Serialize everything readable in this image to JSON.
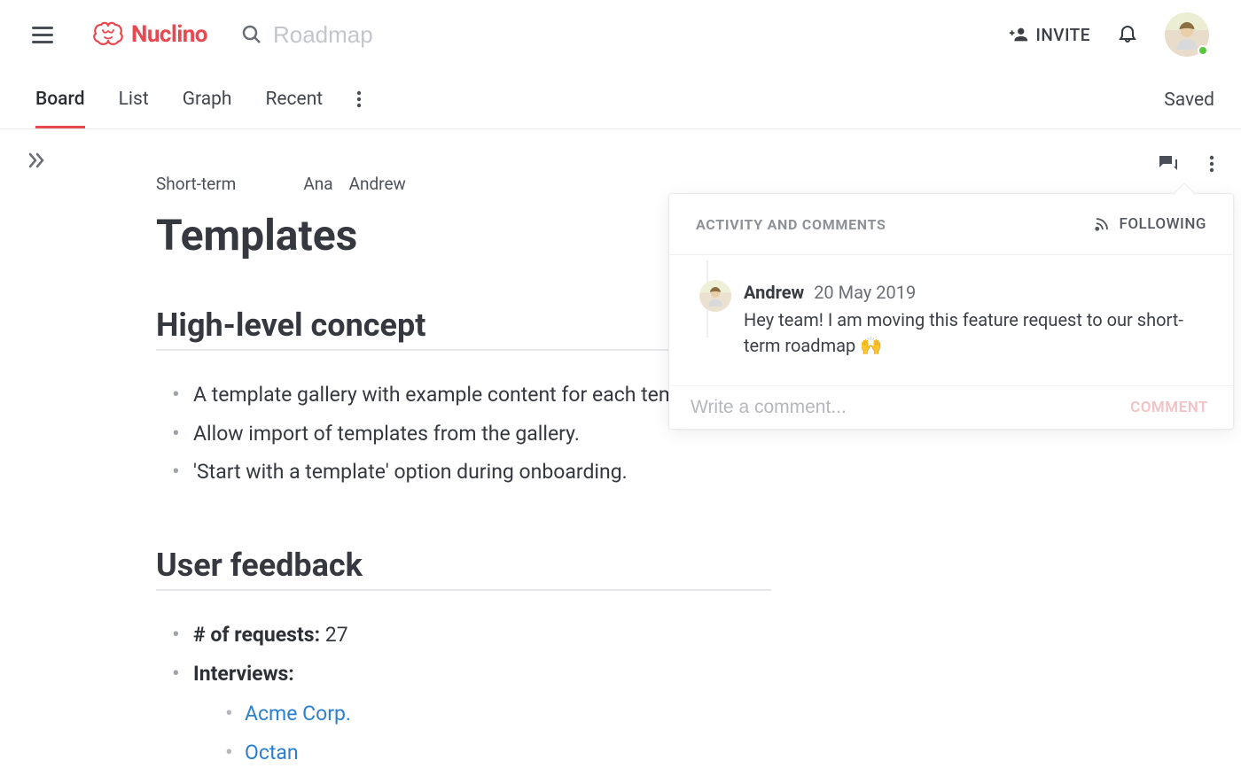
{
  "header": {
    "brand": "Nuclino",
    "search_placeholder": "Roadmap",
    "invite_label": "INVITE"
  },
  "tabs": {
    "items": [
      "Board",
      "List",
      "Graph",
      "Recent"
    ],
    "active_index": 0,
    "status": "Saved"
  },
  "doc": {
    "breadcrumb": "Short-term",
    "collaborators": [
      "Ana",
      "Andrew"
    ],
    "title": "Templates",
    "section1": {
      "heading": "High-level concept",
      "items": [
        "A template gallery with example content for each template.",
        "Allow import of templates from the gallery.",
        "'Start with a template' option during onboarding."
      ]
    },
    "section2": {
      "heading": "User feedback",
      "requests_label": "# of requests:",
      "requests_value": "27",
      "interviews_label": "Interviews:",
      "interview_links": [
        "Acme Corp.",
        "Octan"
      ]
    }
  },
  "panel": {
    "title": "ACTIVITY AND COMMENTS",
    "following_label": "FOLLOWING",
    "comment": {
      "author": "Andrew",
      "date": "20 May 2019",
      "text": "Hey team! I am moving this feature request to our short-term roadmap ",
      "emoji": "🙌"
    },
    "input_placeholder": "Write a comment...",
    "submit_label": "COMMENT"
  }
}
